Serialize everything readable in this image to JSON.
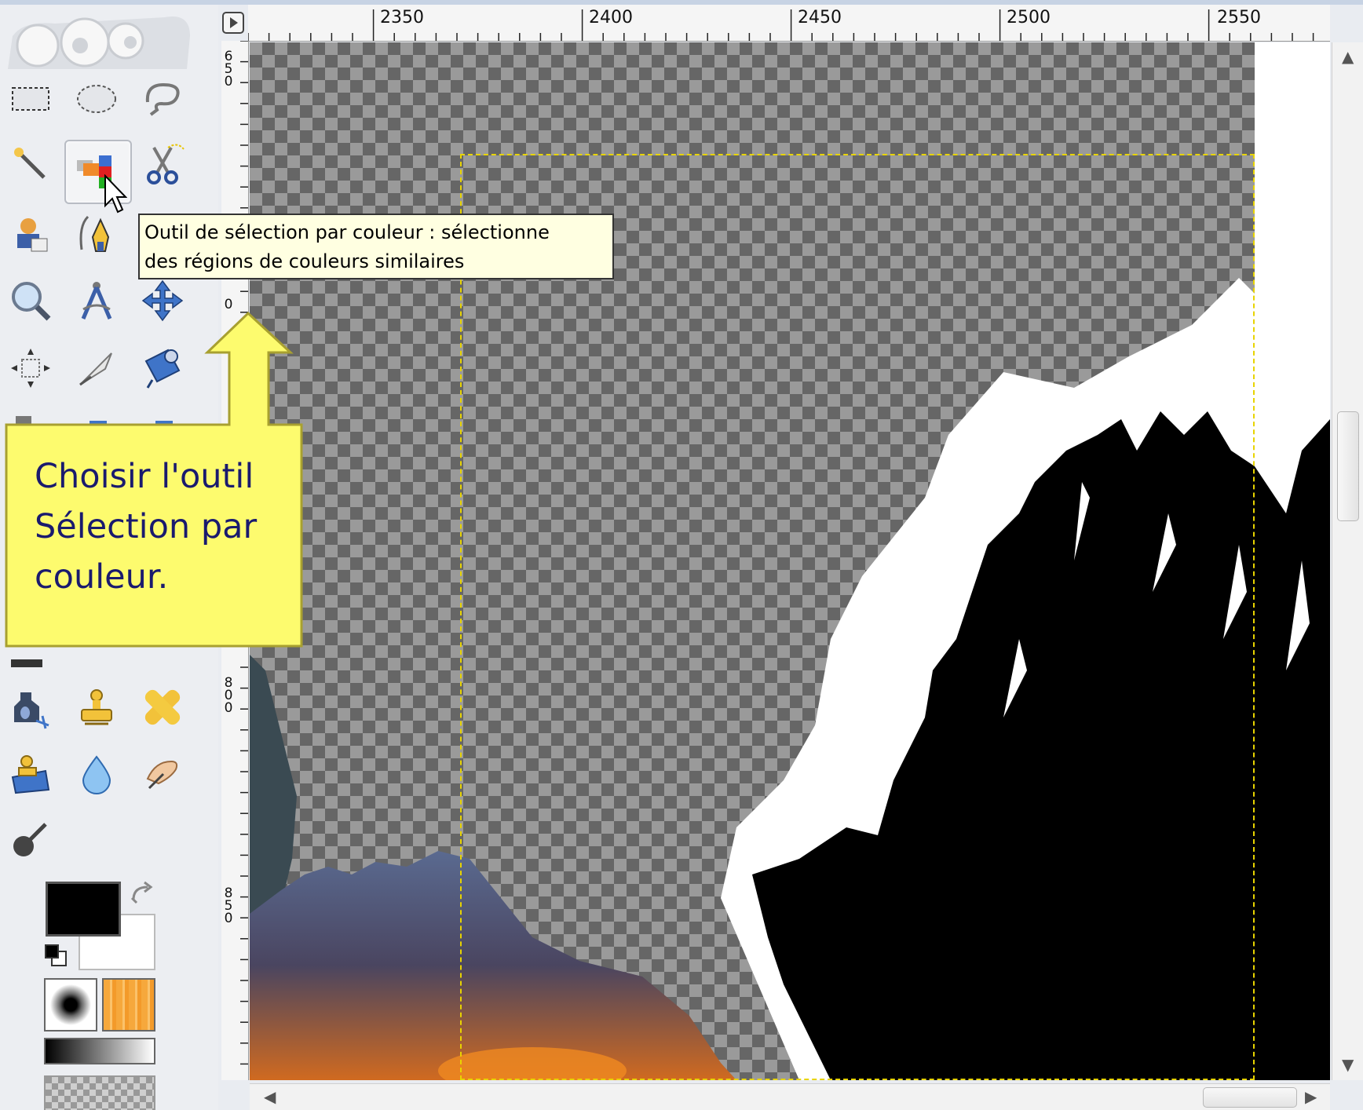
{
  "ruler": {
    "top_labels": [
      "2350",
      "2400",
      "2450",
      "2500",
      "2550"
    ],
    "left_labels": [
      [
        "6",
        "5",
        "0"
      ],
      [
        "0"
      ],
      [
        "8",
        "0",
        "0"
      ],
      [
        "8",
        "5",
        "0"
      ]
    ]
  },
  "tooltip": {
    "line1": "Outil de sélection par couleur : sélectionne",
    "line2": "des régions de couleurs similaires"
  },
  "callout": {
    "line1": "Choisir l'outil",
    "line2": "Sélection par",
    "line3": "couleur."
  },
  "colors": {
    "foreground": "#000000",
    "background": "#ffffff",
    "selection_marquee": "#e8d400",
    "callout_fill": "#fdfb6e",
    "tooltip_fill": "#ffffe1"
  },
  "tools": [
    "rect-select-icon",
    "ellipse-select-icon",
    "free-select-icon",
    "fuzzy-select-icon",
    "select-by-color-icon",
    "scissors-select-icon",
    "foreground-select-icon",
    "paths-icon",
    "color-picker-icon",
    "zoom-icon",
    "measure-icon",
    "move-icon",
    "align-icon",
    "crop-icon",
    "transform-icon",
    "ink-icon",
    "clone-icon",
    "heal-icon",
    "perspective-clone-icon",
    "blur-icon",
    "smudge-icon",
    "dodge-burn-icon"
  ]
}
